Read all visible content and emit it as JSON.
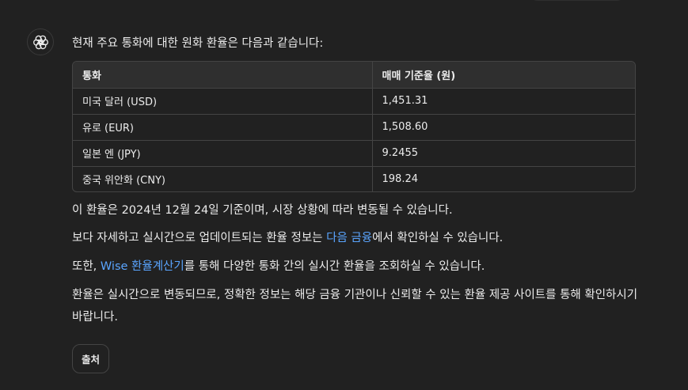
{
  "message": {
    "intro": "현재 주요 통화에 대한 원화 환율은 다음과 같습니다:",
    "table": {
      "headers": [
        "통화",
        "매매 기준율 (원)"
      ],
      "rows": [
        [
          "미국 달러 (USD)",
          "1,451.31"
        ],
        [
          "유로 (EUR)",
          "1,508.60"
        ],
        [
          "일본 엔 (JPY)",
          "9.2455"
        ],
        [
          "중국 위안화 (CNY)",
          "198.24"
        ]
      ]
    },
    "p1": "이 환율은 2024년 12월 24일 기준이며, 시장 상황에 따라 변동될 수 있습니다.",
    "p2_before": "보다 자세하고 실시간으로 업데이트되는 환율 정보는 ",
    "p2_link": "다음 금융",
    "p2_after": "에서 확인하실 수 있습니다.",
    "p3_before": "또한, ",
    "p3_link": "Wise 환율계산기",
    "p3_after": "를 통해 다양한 통화 간의 실시간 환율을 조회하실 수 있습니다.",
    "p4": "환율은 실시간으로 변동되므로, 정확한 정보는 해당 금융 기관이나 신뢰할 수 있는 환율 제공 사이트를 통해 확인하시기 바랍니다.",
    "sources_button": "출처"
  },
  "icons": {
    "avatar": "openai-logo-icon"
  },
  "colors": {
    "background": "#212121",
    "link": "#5aa5ff",
    "table_header_bg": "#2f2f2f"
  }
}
